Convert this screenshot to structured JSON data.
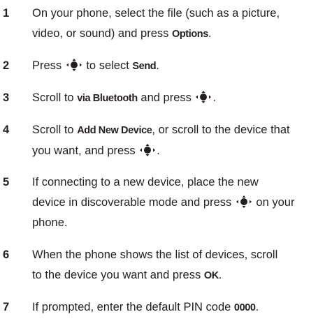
{
  "icons": {
    "nav_key": "nav-key-select-icon"
  },
  "steps": [
    {
      "num": "1",
      "line1_a": "On your phone, select the file (such as a picture,",
      "line2_a": "video, or sound) and press ",
      "line2_b": "Options",
      "line2_c": "."
    },
    {
      "num": "2",
      "a": "Press ",
      "b": " to select ",
      "c": "Send",
      "d": "."
    },
    {
      "num": "3",
      "a": "Scroll to ",
      "b": "via Bluetooth",
      "c": " and press ",
      "d": "."
    },
    {
      "num": "4",
      "line1_a": "Scroll to ",
      "line1_b": "Add New Device",
      "line1_c": ", or scroll to the device that",
      "line2_a": "you want, and press ",
      "line2_b": "."
    },
    {
      "num": "5",
      "line1": "If connecting to a new device, place the new",
      "line2_a": "device in discoverable mode and press ",
      "line2_b": " on your",
      "line3": "phone."
    },
    {
      "num": "6",
      "line1": "When the phone shows the list of devices, scroll",
      "line2_a": "to the device you want and press ",
      "line2_b": "OK",
      "line2_c": "."
    },
    {
      "num": "7",
      "a": "If prompted, enter the default PIN code ",
      "b": "0000",
      "c": "."
    }
  ]
}
